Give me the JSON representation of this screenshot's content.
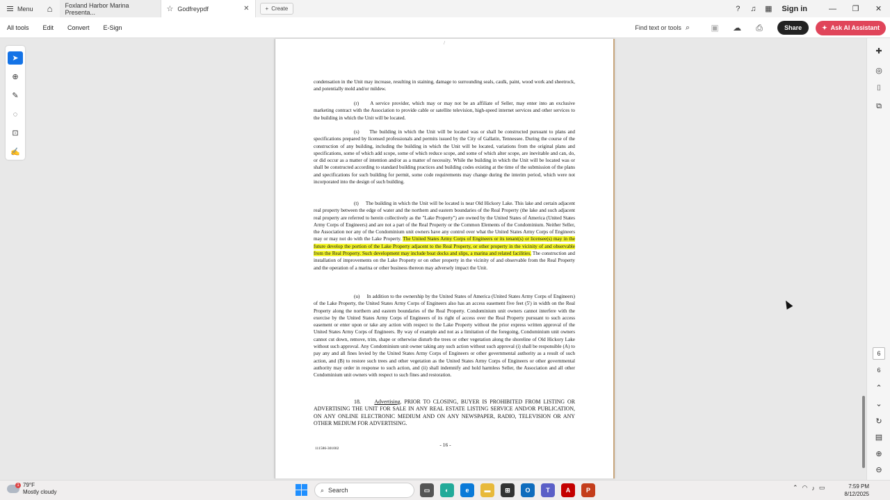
{
  "titlebar": {
    "menu_label": "Menu",
    "tabs": [
      {
        "label": "Foxland Harbor Marina Presenta..."
      },
      {
        "label": "Godfreypdf"
      }
    ],
    "create_label": "Create",
    "signin_label": "Sign in"
  },
  "toolbar": {
    "items": [
      "All tools",
      "Edit",
      "Convert",
      "E-Sign"
    ],
    "find_label": "Find text or tools",
    "share_label": "Share",
    "ai_label": "Ask AI Assistant"
  },
  "document": {
    "page_top_mark": "/",
    "para_q_tail": "condensation in the Unit may increase, resulting in staining, damage to surrounding seals, caulk, paint, wood work and sheetrock, and potentially mold and/or mildew.",
    "para_r": "(r)     A service provider, which may or may not be an affiliate of Seller, may enter into an exclusive marketing contract with the Association to provide cable or satellite television, high-speed internet services and other services to the building in which the Unit will be located.",
    "para_s": "(s)     The building in which the Unit will be located was or shall be constructed pursuant to plans and specifications prepared by licensed professionals and permits issued by the City of Gallatin, Tennessee. During the course of the construction of any building, including the building in which the Unit will be located, variations from the original plans and specifications, some of which add scope, some of which reduce scope, and some of which alter scope, are inevitable and can, do, or did occur as a matter of intention and/or as a matter of necessity. While the building in which the Unit will be located was or shall be constructed according to standard building practices and building codes existing at the time of the submission of the plans and specifications for such building for permit, some code requirements may change during the interim period, which were not incorporated into the design of such building.",
    "para_t_pre": "(t)     The building in which the Unit will be located is near Old Hickory Lake. This lake and certain adjacent real property between the edge of water and the northern and eastern boundaries of the Real Property (the lake and such adjacent real property are referred to herein collectively as the \"Lake Property\") are owned by the United States of America (United States Army Corps of Engineers) and are not a part of the Real Property or the Common Elements of the Condominium. Neither Seller, the Association nor any of the Condominium unit owners have any control over what the United States Army Corps of Engineers may or may not do with the Lake Property. ",
    "para_t_highlight": "The United States Army Corps of Engineers or its tenant(s) or licensee(s) may in the future develop the portion of the Lake Property adjacent to the Real Property, or other property in the vicinity of and observable from the Real Property. Such development may include boat docks and slips, a marina and related facilities.",
    "para_t_post": " The construction and installation of improvements on the Lake Property or on other property in the vicinity of and observable from the Real Property and the operation of a marina or other business thereon may adversely impact the Unit.",
    "para_u": "(u)     In addition to the ownership by the United States of America (United States Army Corps of Engineers) of the Lake Property, the United States Army Corps of Engineers also has an access easement five feet (5') in width on the Real Property along the northern and eastern boundaries of the Real Property. Condominium unit owners cannot interfere with the exercise by the United States Army Corps of Engineers of its right of access over the Real Property pursuant to such access easement or enter upon or take any action with respect to the Lake Property without the prior express written approval of the United States Army Corps of Engineers. By way of example and not as a limitation of the foregoing, Condominium unit owners cannot cut down, remove, trim, shape or otherwise disturb the trees or other vegetation along the shoreline of Old Hickory Lake without such approval. Any Condominium unit owner taking any such action without such approval (i) shall be responsible (A) to pay any and all fines levied by the United States Army Corps of Engineers or other governmental authority as a result of such action, and (B) to restore such trees and other vegetation as the United States Army Corps of Engineers or other governmental authority may order in response to such action, and (ii) shall indemnify and hold harmless Seller, the Association and all other Condominium unit owners with respect to such fines and restoration.",
    "sec18_num": "18.",
    "sec18_title": "Advertising",
    "sec18_text": ". PRIOR TO CLOSING, BUYER IS PROHIBITED FROM LISTING OR ADVERTISING THE UNIT FOR SALE IN ANY REAL ESTATE LISTING SERVICE AND/OR PUBLICATION, ON ANY ONLINE ELECTRONIC MEDIUM AND ON ANY NEWSPAPER, RADIO, TELEVISION OR ANY OTHER MEDIUM FOR ADVERTISING.",
    "page_number": "- 16 -",
    "doc_id": "111586-301002"
  },
  "rightrail": {
    "page_box": "6",
    "page_total": "6"
  },
  "taskbar": {
    "temp": "79°F",
    "weather": "Mostly cloudy",
    "weather_badge": "1",
    "search_label": "Search",
    "time": "7:59 PM",
    "date": "8/12/2025"
  },
  "colors": {
    "highlight": "#f3f52b",
    "ai_button": "#e0455a",
    "active_tool": "#1473e6"
  }
}
